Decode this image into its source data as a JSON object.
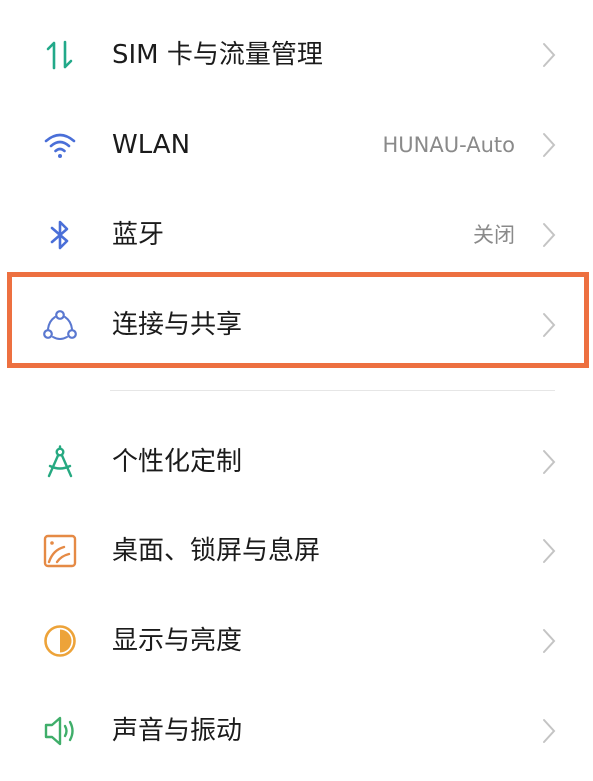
{
  "settings": {
    "items": [
      {
        "label": "SIM 卡与流量管理",
        "value": "",
        "icon": "data-transfer-icon",
        "icon_color": "#22a989"
      },
      {
        "label": "WLAN",
        "value": "HUNAU-Auto",
        "icon": "wifi-icon",
        "icon_color": "#4a6fd8"
      },
      {
        "label": "蓝牙",
        "value": "关闭",
        "icon": "bluetooth-icon",
        "icon_color": "#4a6fd8"
      },
      {
        "label": "连接与共享",
        "value": "",
        "icon": "connection-share-icon",
        "icon_color": "#5a78d0"
      },
      {
        "label": "个性化定制",
        "value": "",
        "icon": "compass-icon",
        "icon_color": "#26a981"
      },
      {
        "label": "桌面、锁屏与息屏",
        "value": "",
        "icon": "wallpaper-icon",
        "icon_color": "#e58a45"
      },
      {
        "label": "显示与亮度",
        "value": "",
        "icon": "brightness-icon",
        "icon_color": "#eda339"
      },
      {
        "label": "声音与振动",
        "value": "",
        "icon": "sound-vibration-icon",
        "icon_color": "#3fae6a"
      }
    ]
  },
  "highlight_color": "#ed7040"
}
